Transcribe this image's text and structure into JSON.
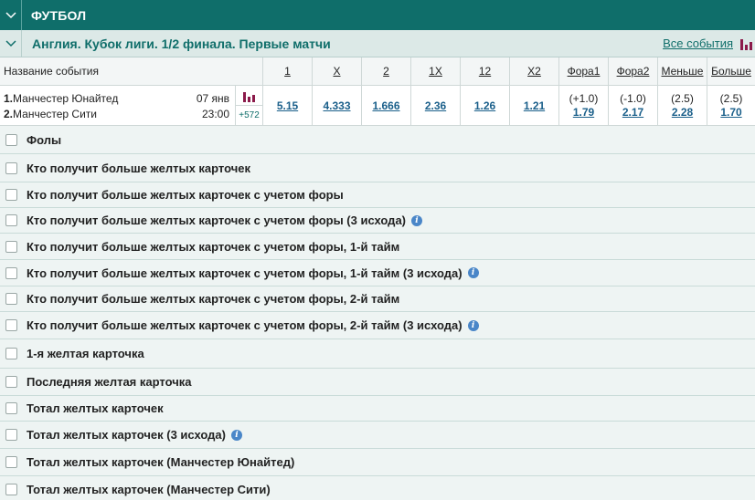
{
  "sport": {
    "title": "ФУТБОЛ"
  },
  "league": {
    "title": "Англия. Кубок лиги. 1/2 финала. Первые матчи",
    "all_events": "Все события"
  },
  "table": {
    "headers": {
      "name": "Название события",
      "c1": "1",
      "c2": "X",
      "c3": "2",
      "c4": "1X",
      "c5": "12",
      "c6": "X2",
      "c7": "Фора1",
      "c8": "Фора2",
      "c9": "Меньше",
      "c10": "Больше"
    },
    "event": {
      "team1_num": "1.",
      "team1": "Манчестер Юнайтед",
      "team2_num": "2.",
      "team2": "Манчестер Сити",
      "date": "07 янв",
      "time": "23:00",
      "more": "+572",
      "odds": {
        "o1": "5.15",
        "ox": "4.333",
        "o2": "1.666",
        "o1x": "2.36",
        "o12": "1.26",
        "ox2": "1.21",
        "f1_par": "(+1.0)",
        "f1": "1.79",
        "f2_par": "(-1.0)",
        "f2": "2.17",
        "u_par": "(2.5)",
        "u": "2.28",
        "o_par": "(2.5)",
        "o": "1.70"
      }
    }
  },
  "markets": [
    {
      "label": "Фолы"
    },
    {
      "label": "Кто получит больше желтых карточек"
    },
    {
      "label": "Кто получит больше желтых карточек с учетом форы"
    },
    {
      "label": "Кто получит больше желтых карточек с учетом форы (3 исхода)"
    },
    {
      "label": "Кто получит больше желтых карточек с учетом форы, 1-й тайм"
    },
    {
      "label": "Кто получит больше желтых карточек с учетом форы, 1-й тайм (3 исхода)"
    },
    {
      "label": "Кто получит больше желтых карточек с учетом форы, 2-й тайм"
    },
    {
      "label": "Кто получит больше желтых карточек с учетом форы, 2-й тайм (3 исхода)"
    },
    {
      "label": "1-я желтая карточка"
    },
    {
      "label": "Последняя желтая карточка"
    },
    {
      "label": "Тотал желтых карточек"
    },
    {
      "label": "Тотал желтых карточек (3 исхода)"
    },
    {
      "label": "Тотал желтых карточек (Манчестер Юнайтед)"
    },
    {
      "label": "Тотал желтых карточек (Манчестер Сити)"
    }
  ],
  "info_icon": "i",
  "colors": {
    "brand": "#0f6e6a",
    "odds": "#1a5f8a",
    "stat": "#8b1a4a"
  }
}
